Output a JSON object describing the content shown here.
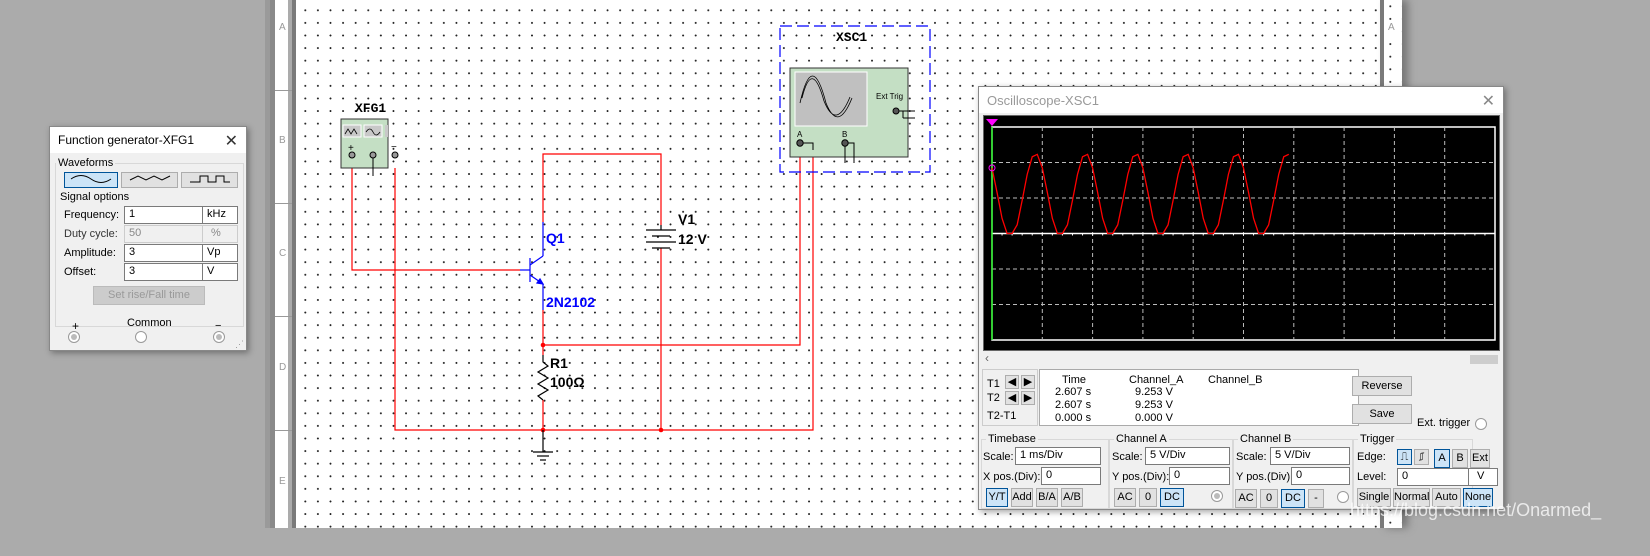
{
  "schematic": {
    "row_labels": [
      "A",
      "B",
      "C",
      "D",
      "E"
    ],
    "right_row_labels": [
      "A",
      "B"
    ],
    "components": {
      "xfg_ref": "XFG1",
      "xsc_ref": "XSC1",
      "xsc_ext_trig": "Ext Trig",
      "xsc_a": "A",
      "xsc_b": "B",
      "q_ref": "Q1",
      "q_model": "2N2102",
      "v_ref": "V1",
      "v_value": "12 V",
      "r_ref": "R1",
      "r_value": "100Ω"
    },
    "wire_color": "#ff0000",
    "part_color": "#0000ff"
  },
  "function_generator": {
    "title": "Function generator-XFG1",
    "waveforms_label": "Waveforms",
    "waveforms": [
      {
        "icon": "sine-wave-icon",
        "selected": true
      },
      {
        "icon": "triangle-wave-icon",
        "selected": false
      },
      {
        "icon": "square-wave-icon",
        "selected": false
      }
    ],
    "signal_options_label": "Signal options",
    "rows": [
      {
        "label": "Frequency:",
        "value": "1",
        "unit": "kHz",
        "enabled": true
      },
      {
        "label": "Duty cycle:",
        "value": "50",
        "unit": "%",
        "enabled": false
      },
      {
        "label": "Amplitude:",
        "value": "3",
        "unit": "Vp",
        "enabled": true
      },
      {
        "label": "Offset:",
        "value": "3",
        "unit": "V",
        "enabled": true
      }
    ],
    "rise_fall_button": "Set rise/Fall time",
    "terminals": {
      "plus": "+",
      "common": "Common",
      "minus": "−"
    }
  },
  "oscilloscope": {
    "title": "Oscilloscope-XSC1",
    "cursor_table": {
      "row_labels": [
        "T1",
        "T2",
        "T2-T1"
      ],
      "headers": [
        "Time",
        "Channel_A",
        "Channel_B"
      ],
      "rows": [
        [
          "2.607 s",
          "9.253 V",
          ""
        ],
        [
          "2.607 s",
          "9.253 V",
          ""
        ],
        [
          "0.000 s",
          "0.000 V",
          ""
        ]
      ]
    },
    "reverse_button": "Reverse",
    "save_button": "Save",
    "ext_trigger_label": "Ext. trigger",
    "timebase": {
      "label": "Timebase",
      "scale_label": "Scale:",
      "scale": "1 ms/Div",
      "xpos_label": "X pos.(Div):",
      "xpos": "0",
      "buttons": [
        {
          "label": "Y/T",
          "on": true
        },
        {
          "label": "Add",
          "on": false
        },
        {
          "label": "B/A",
          "on": false
        },
        {
          "label": "A/B",
          "on": false
        }
      ]
    },
    "channel_a": {
      "label": "Channel A",
      "scale_label": "Scale:",
      "scale": "5  V/Div",
      "ypos_label": "Y pos.(Div):",
      "ypos": "0",
      "buttons": [
        {
          "label": "AC",
          "on": false
        },
        {
          "label": "0",
          "on": false
        },
        {
          "label": "DC",
          "on": true
        }
      ]
    },
    "channel_b": {
      "label": "Channel B",
      "scale_label": "Scale:",
      "scale": "5  V/Div",
      "ypos_label": "Y pos.(Div):",
      "ypos": "0",
      "buttons": [
        {
          "label": "AC",
          "on": false
        },
        {
          "label": "0",
          "on": false
        },
        {
          "label": "DC",
          "on": true
        },
        {
          "label": "-",
          "on": false
        }
      ]
    },
    "trigger": {
      "label": "Trigger",
      "edge_label": "Edge:",
      "level_label": "Level:",
      "level": "0",
      "level_unit": "V",
      "source_buttons": [
        {
          "label": "A",
          "on": true
        },
        {
          "label": "B",
          "on": false
        },
        {
          "label": "Ext",
          "on": false
        }
      ],
      "mode_buttons": [
        {
          "label": "Single",
          "on": false
        },
        {
          "label": "Normal",
          "on": false
        },
        {
          "label": "Auto",
          "on": false
        },
        {
          "label": "None",
          "on": true
        }
      ]
    }
  },
  "watermark": "https://blog.csdn.net/Onarmed_",
  "chart_data": {
    "type": "line",
    "grid": true,
    "x_unit": "ms",
    "y_unit": "V",
    "xlim": [
      0,
      10
    ],
    "ylim": [
      -15,
      15
    ],
    "x_divisions": 10,
    "y_divisions": 6,
    "series": [
      {
        "channel": "A",
        "color": "#ff0000",
        "x": [
          0,
          0.1,
          0.2,
          0.3,
          0.4,
          0.5,
          0.6,
          0.7,
          0.8,
          0.9,
          1,
          1.1,
          1.2,
          1.3,
          1.4,
          1.5,
          1.6,
          1.7,
          1.8,
          1.9,
          2,
          2.1,
          2.2,
          2.3,
          2.4,
          2.5,
          2.6,
          2.7,
          2.8,
          2.9,
          3,
          3.1,
          3.2,
          3.3,
          3.4,
          3.5,
          3.6,
          3.7,
          3.8,
          3.9,
          4,
          4.1,
          4.2,
          4.3,
          4.4,
          4.5,
          4.6,
          4.7,
          4.8,
          4.9,
          5,
          5.1,
          5.2,
          5.3,
          5.4,
          5.5,
          5.6,
          5.7,
          5.8,
          5.9
        ],
        "y": [
          9.24,
          5.79,
          2.13,
          0,
          0,
          1.22,
          4.67,
          8.33,
          10.81,
          11.15,
          9.24,
          5.79,
          2.13,
          0,
          0,
          1.22,
          4.67,
          8.33,
          10.81,
          11.15,
          9.24,
          5.79,
          2.13,
          0,
          0,
          1.22,
          4.67,
          8.33,
          10.81,
          11.15,
          9.24,
          5.79,
          2.13,
          0,
          0,
          1.22,
          4.67,
          8.33,
          10.81,
          11.15,
          9.24,
          5.79,
          2.13,
          0,
          0,
          1.22,
          4.67,
          8.33,
          10.81,
          11.15,
          9.24,
          5.79,
          2.13,
          0,
          0,
          1.22,
          4.67,
          8.33,
          10.81,
          11.15
        ]
      }
    ]
  }
}
